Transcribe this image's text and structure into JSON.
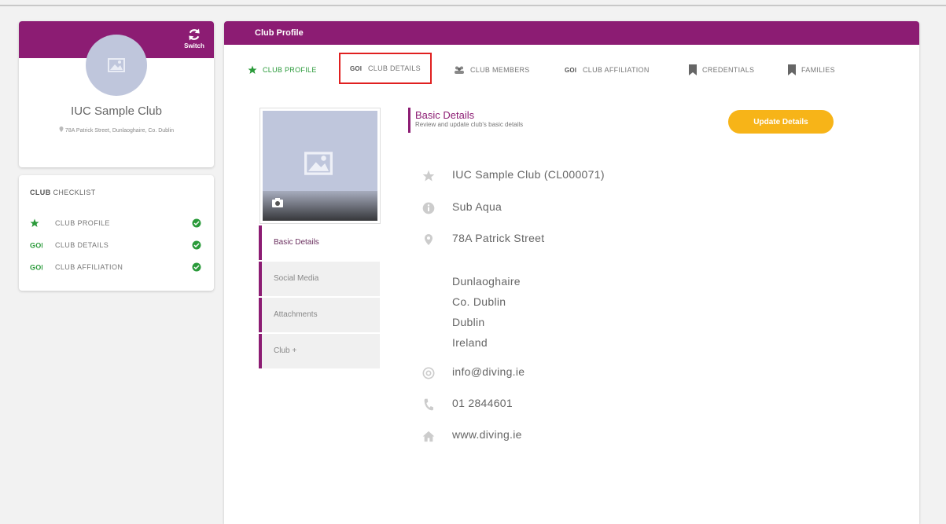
{
  "sidebar": {
    "switch_label": "Switch",
    "club_name": "IUC Sample Club",
    "club_address": "78A Patrick Street, Dunlaoghaire, Co. Dublin"
  },
  "checklist": {
    "title_bold": "CLUB",
    "title_rest": " CHECKLIST",
    "items": [
      {
        "label": "CLUB PROFILE",
        "icon": "star-icon",
        "done": true
      },
      {
        "label": "CLUB DETAILS",
        "icon": "goi-icon",
        "done": true
      },
      {
        "label": "CLUB AFFILIATION",
        "icon": "goi-icon",
        "done": true
      }
    ]
  },
  "main": {
    "title": "Club Profile",
    "tabs": [
      {
        "label": "CLUB PROFILE",
        "icon": "star-icon",
        "active": true
      },
      {
        "label": "CLUB DETAILS",
        "icon": "goi-icon",
        "highlighted": true
      },
      {
        "label": "CLUB MEMBERS",
        "icon": "members-icon"
      },
      {
        "label": "CLUB AFFILIATION",
        "icon": "goi-icon"
      },
      {
        "label": "CREDENTIALS",
        "icon": "bookmark-icon"
      },
      {
        "label": "FAMILIES",
        "icon": "bookmark-icon"
      }
    ],
    "side_menu": [
      "Basic Details",
      "Social Media",
      "Attachments",
      "Club +"
    ],
    "section": {
      "title": "Basic Details",
      "subtitle": "Review and update club's basic details",
      "update_button": "Update Details"
    },
    "details": {
      "name": "IUC Sample Club (CL000071)",
      "type": "Sub Aqua",
      "street": "78A Patrick Street",
      "address_lines": [
        "Dunlaoghaire",
        "Co. Dublin",
        "Dublin",
        "Ireland"
      ],
      "email": "info@diving.ie",
      "phone": "01 2844601",
      "website": "www.diving.ie"
    }
  },
  "colors": {
    "brand": "#8c1c73",
    "accent": "#f7b418",
    "success": "#2a9a3a",
    "highlight": "#e02020"
  }
}
